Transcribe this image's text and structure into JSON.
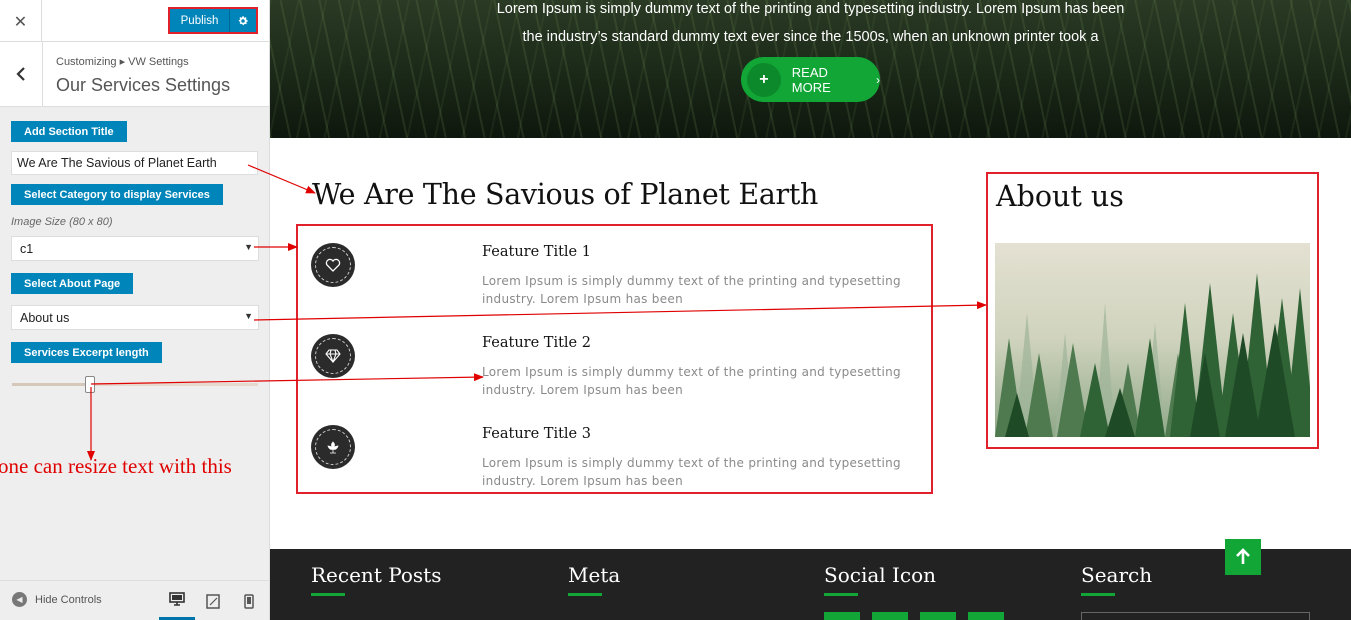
{
  "customizer": {
    "close_glyph": "✕",
    "publish_label": "Publish",
    "breadcrumb": "Customizing ▸ VW Settings",
    "section_title": "Our Services Settings",
    "controls": {
      "section_title_label": "Add Section Title",
      "section_title_value": "We Are The Savious of Planet Earth",
      "category_label": "Select Category to display Services",
      "image_size_note": "Image Size (80 x 80)",
      "category_value": "c1",
      "about_label": "Select About Page",
      "about_value": "About us",
      "excerpt_label": "Services Excerpt length",
      "excerpt_level": 0.32
    },
    "hide_controls_label": "Hide Controls",
    "devices": [
      "desktop-icon",
      "tablet-icon",
      "mobile-icon"
    ],
    "accent_color": "#0085ba"
  },
  "annotation": {
    "resize_note": "one can resize text with this",
    "color": "#e00000"
  },
  "preview": {
    "hero": {
      "line1": "Lorem Ipsum is simply dummy text of the printing and typesetting industry. Lorem Ipsum has been",
      "line2": "the industry’s standard dummy text ever since the 1500s, when an unknown printer took a",
      "button_label": "READ MORE",
      "button_icon": "plus-icon",
      "button_color": "#11a636"
    },
    "services": {
      "title": "We Are The Savious of Planet Earth",
      "features": [
        {
          "icon": "heart-icon",
          "title": "Feature Title 1",
          "text": "Lorem Ipsum is simply dummy text of the printing and typesetting industry. Lorem Ipsum has been"
        },
        {
          "icon": "diamond-icon",
          "title": "Feature Title 2",
          "text": "Lorem Ipsum is simply dummy text of the printing and typesetting industry. Lorem Ipsum has been"
        },
        {
          "icon": "leaf-icon",
          "title": "Feature Title 3",
          "text": "Lorem Ipsum is simply dummy text of the printing and typesetting industry. Lorem Ipsum has been"
        }
      ]
    },
    "about": {
      "title": "About us",
      "image": "forest-image"
    },
    "footer": {
      "headings": [
        "Recent Posts",
        "Meta",
        "Social Icon",
        "Search"
      ],
      "accent_color": "#11a636"
    }
  }
}
